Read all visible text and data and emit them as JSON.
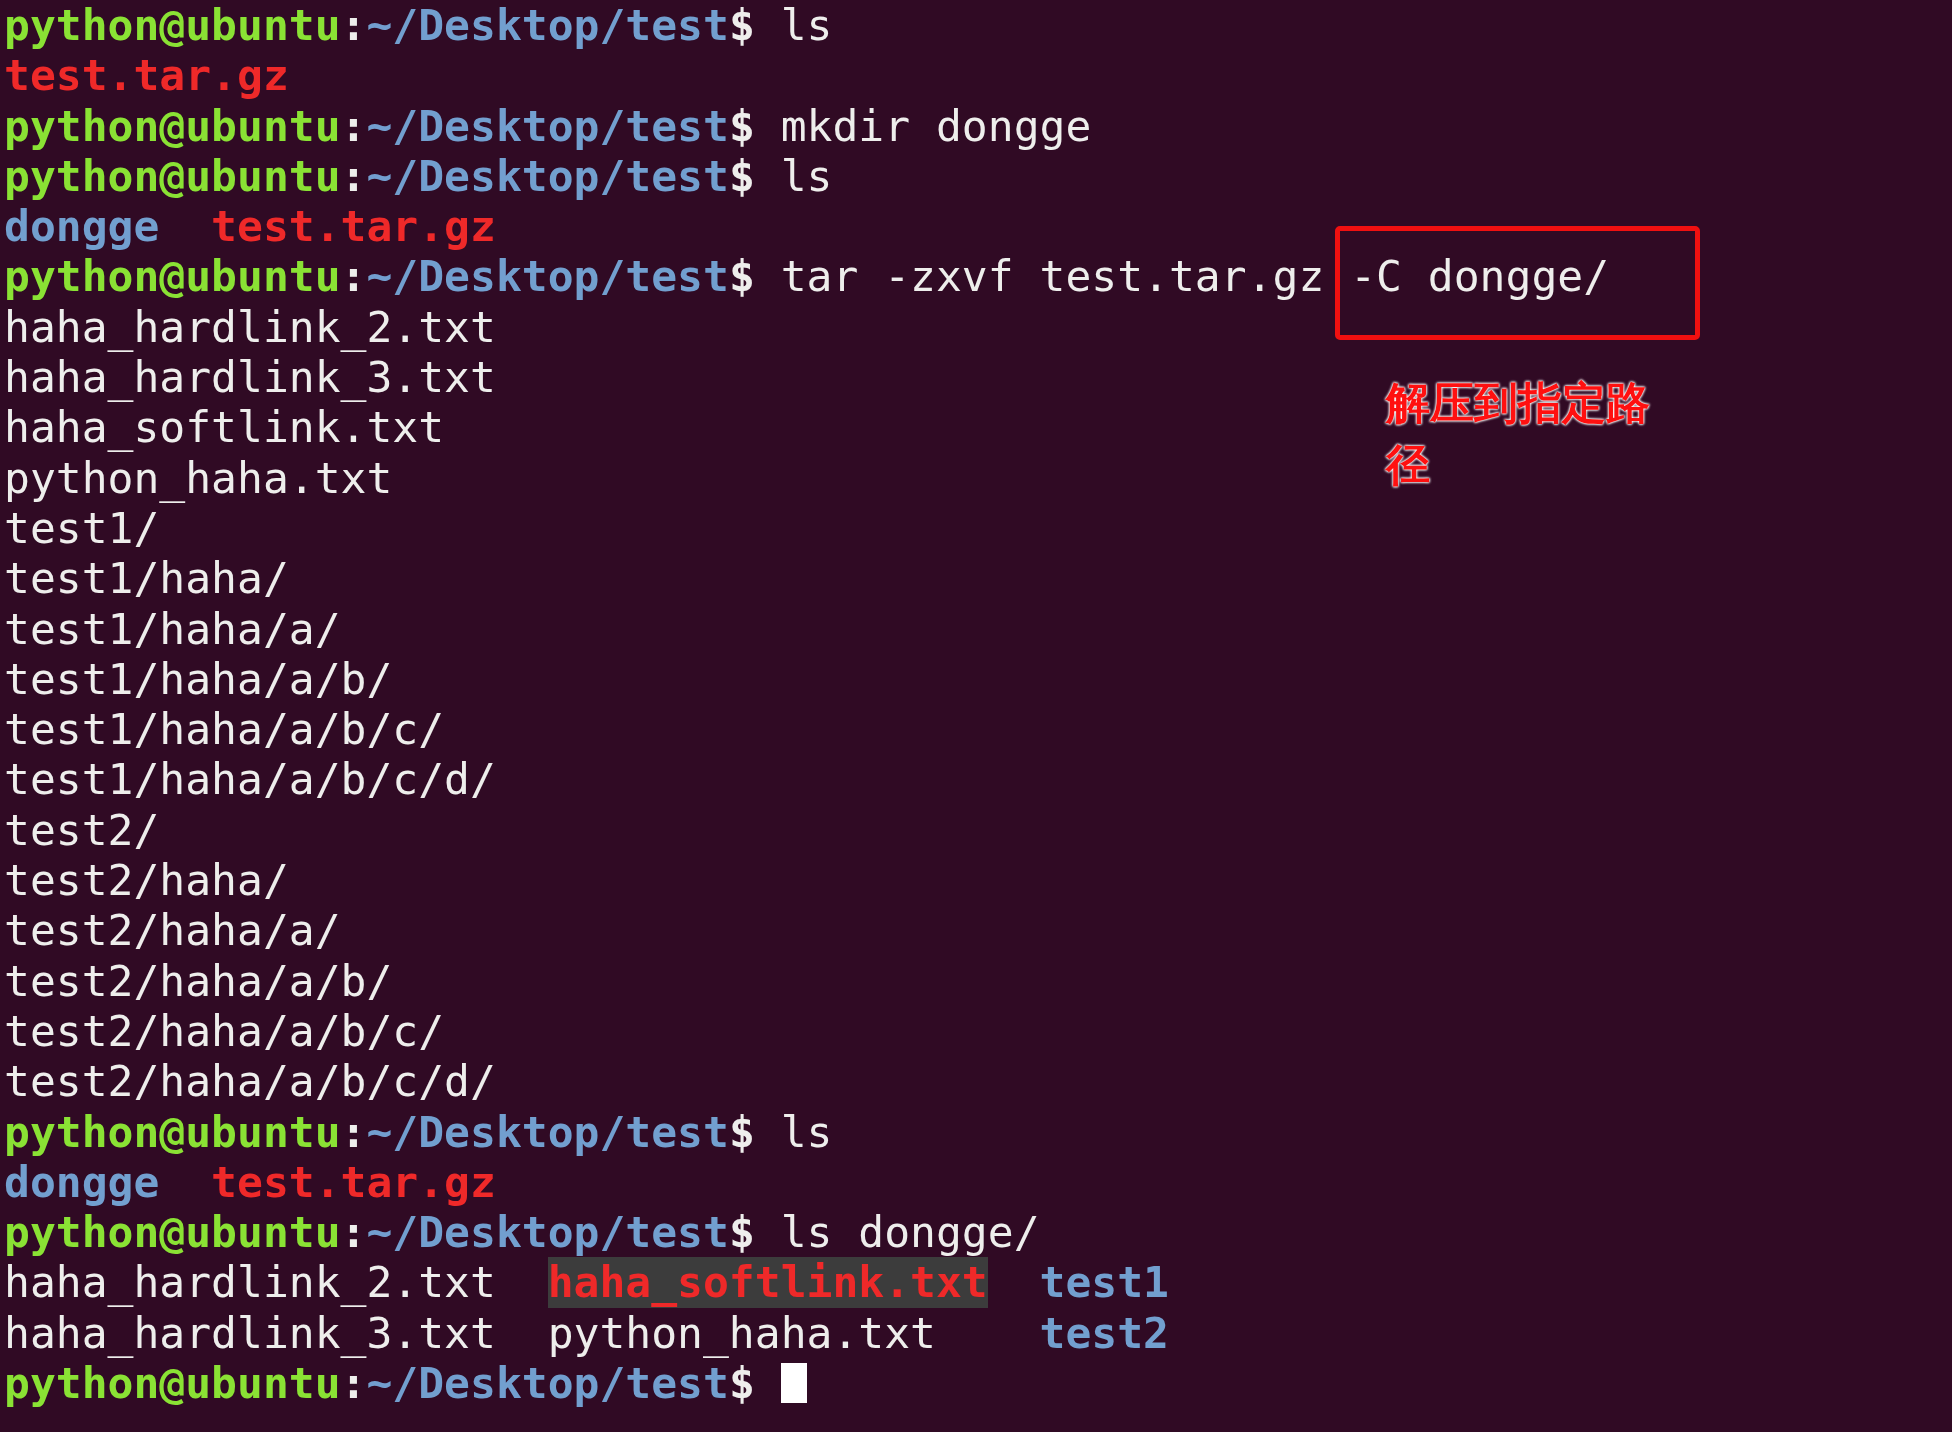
{
  "terminal": {
    "lines": [
      {
        "kind": "prompt",
        "user": "python@ubuntu",
        "separator": ":",
        "path": "~/Desktop/test",
        "symbol": "$",
        "command": "ls"
      },
      {
        "kind": "listing",
        "rows": [
          [
            {
              "name": "test.tar.gz",
              "kind": "archive"
            }
          ]
        ]
      },
      {
        "kind": "prompt",
        "user": "python@ubuntu",
        "separator": ":",
        "path": "~/Desktop/test",
        "symbol": "$",
        "command": "mkdir dongge"
      },
      {
        "kind": "prompt",
        "user": "python@ubuntu",
        "separator": ":",
        "path": "~/Desktop/test",
        "symbol": "$",
        "command": "ls"
      },
      {
        "kind": "listing",
        "rows": [
          [
            {
              "name": "dongge",
              "kind": "directory"
            },
            {
              "name": "test.tar.gz",
              "kind": "archive"
            }
          ]
        ]
      },
      {
        "kind": "prompt",
        "user": "python@ubuntu",
        "separator": ":",
        "path": "~/Desktop/test",
        "symbol": "$",
        "command": "tar -zxvf test.tar.gz -C dongge/"
      },
      {
        "kind": "output",
        "text": "haha_hardlink_2.txt"
      },
      {
        "kind": "output",
        "text": "haha_hardlink_3.txt"
      },
      {
        "kind": "output",
        "text": "haha_softlink.txt"
      },
      {
        "kind": "output",
        "text": "python_haha.txt"
      },
      {
        "kind": "output",
        "text": "test1/"
      },
      {
        "kind": "output",
        "text": "test1/haha/"
      },
      {
        "kind": "output",
        "text": "test1/haha/a/"
      },
      {
        "kind": "output",
        "text": "test1/haha/a/b/"
      },
      {
        "kind": "output",
        "text": "test1/haha/a/b/c/"
      },
      {
        "kind": "output",
        "text": "test1/haha/a/b/c/d/"
      },
      {
        "kind": "output",
        "text": "test2/"
      },
      {
        "kind": "output",
        "text": "test2/haha/"
      },
      {
        "kind": "output",
        "text": "test2/haha/a/"
      },
      {
        "kind": "output",
        "text": "test2/haha/a/b/"
      },
      {
        "kind": "output",
        "text": "test2/haha/a/b/c/"
      },
      {
        "kind": "output",
        "text": "test2/haha/a/b/c/d/"
      },
      {
        "kind": "prompt",
        "user": "python@ubuntu",
        "separator": ":",
        "path": "~/Desktop/test",
        "symbol": "$",
        "command": "ls"
      },
      {
        "kind": "listing",
        "rows": [
          [
            {
              "name": "dongge",
              "kind": "directory"
            },
            {
              "name": "test.tar.gz",
              "kind": "archive"
            }
          ]
        ]
      },
      {
        "kind": "prompt",
        "user": "python@ubuntu",
        "separator": ":",
        "path": "~/Desktop/test",
        "symbol": "$",
        "command": "ls dongge/"
      },
      {
        "kind": "listing",
        "rows": [
          [
            {
              "name": "haha_hardlink_2.txt",
              "kind": "file"
            },
            {
              "name": "haha_softlink.txt",
              "kind": "broken-link"
            },
            {
              "name": "test1",
              "kind": "directory"
            }
          ],
          [
            {
              "name": "haha_hardlink_3.txt",
              "kind": "file"
            },
            {
              "name": "python_haha.txt",
              "kind": "file"
            },
            {
              "name": "test2",
              "kind": "directory"
            }
          ]
        ]
      },
      {
        "kind": "prompt",
        "user": "python@ubuntu",
        "separator": ":",
        "path": "~/Desktop/test",
        "symbol": "$",
        "cursor": true
      }
    ]
  },
  "annotation": {
    "note": "解压到指定路径"
  }
}
